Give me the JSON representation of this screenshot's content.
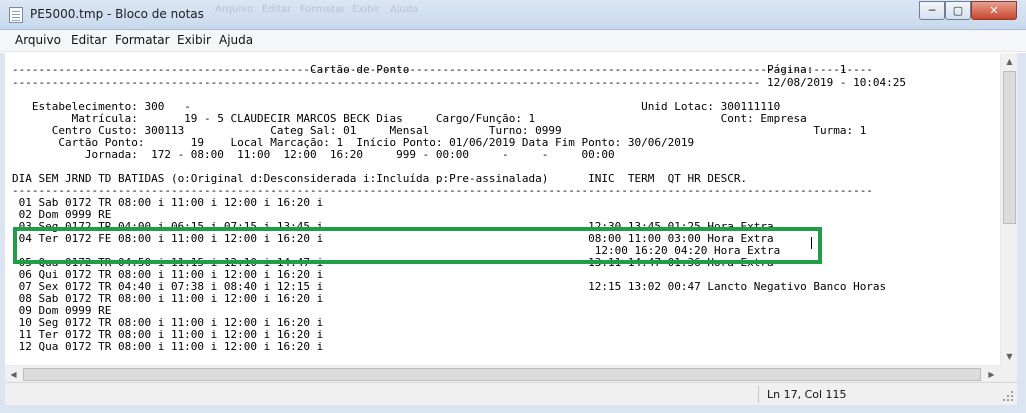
{
  "window": {
    "title": "PE5000.tmp - Bloco de notas",
    "ghost_menu": [
      "Arquivo",
      "Editar",
      "Formatar",
      "Exibir",
      "Ajuda"
    ],
    "controls": {
      "minimize": "─",
      "maximize": "▢",
      "close": "✕"
    }
  },
  "menu": [
    "Arquivo",
    "Editar",
    "Formatar",
    "Exibir",
    "Ajuda"
  ],
  "document": {
    "lines": [
      "----------------------------------------------------------------------------------------------------------------------------------",
      "                                             Cartão de Ponto                                                      Página:    1",
      "----------------------------------------------------------------------------------------------------------------- 12/08/2019 - 10:04:25",
      "",
      "   Estabelecimento: 300   -                                                                    Unid Lotac: 300111110",
      "         Matrícula:       19 - 5 CLAUDECIR MARCOS BECK Dias     Cargo/Função: 1                            Cont: Empresa",
      "      Centro Custo: 300113             Categ Sal: 01     Mensal         Turno: 0999                                      Turma: 1",
      "       Cartão Ponto:       19    Local Marcação: 1  Início Ponto: 01/06/2019 Data Fim Ponto: 30/06/2019",
      "           Jornada:  172 - 08:00  11:00  12:00  16:20     999 - 00:00     -     -     00:00",
      "",
      "DIA SEM JRND TD BATIDAS (o:Original d:Desconsiderada i:Incluída p:Pre-assinalada)      INIC  TERM  QT HR DESCR.",
      "----------------------------------------------------------------------------------------------------------------------------------",
      " 01 Sab 0172 TR 08:00 i 11:00 i 12:00 i 16:20 i",
      " 02 Dom 0999 RE",
      " 03 Seg 0172 TR 04:00 i 06:15 i 07:15 i 13:45 i                                        12:30 13:45 01:25 Hora Extra",
      " 04 Ter 0172 FE 08:00 i 11:00 i 12:00 i 16:20 i                                        08:00 11:00 03:00 Hora Extra",
      "                                                                                        12:00 16:20 04:20 Hora Extra",
      " 05 Qua 0172 TR 04:50 i 11:15 i 12:10 i 14:47 i                                        13:11 14:47 01:36 Hora Extra",
      " 06 Qui 0172 TR 08:00 i 11:00 i 12:00 i 16:20 i",
      " 07 Sex 0172 TR 04:40 i 07:38 i 08:40 i 12:15 i                                        12:15 13:02 00:47 Lancto Negativo Banco Horas",
      " 08 Sab 0172 TR 08:00 i 11:00 i 12:00 i 16:20 i",
      " 09 Dom 0999 RE",
      " 10 Seg 0172 TR 08:00 i 11:00 i 12:00 i 16:20 i",
      " 11 Ter 0172 TR 08:00 i 11:00 i 12:00 i 16:20 i",
      " 12 Qua 0172 TR 08:00 i 11:00 i 12:00 i 16:20 i"
    ]
  },
  "status": {
    "position": "Ln 17, Col 115"
  },
  "colors": {
    "highlight_border": "#1f9e47",
    "titlebar": "#c9d9ee"
  }
}
